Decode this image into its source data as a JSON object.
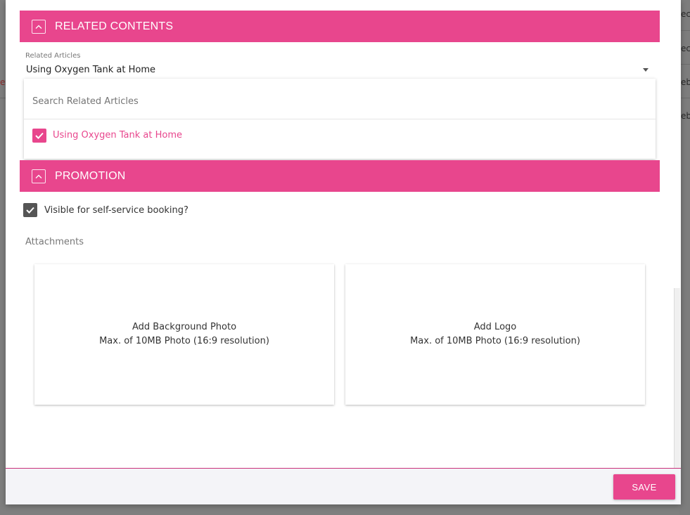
{
  "background": {
    "right_fragments": [
      "ec",
      "ec",
      "eb",
      "eb"
    ],
    "left_fragment": "e"
  },
  "related_contents": {
    "header": "RELATED CONTENTS",
    "field_label": "Related Articles",
    "selected_value": "Using Oxygen Tank at Home",
    "search_placeholder": "Search Related Articles",
    "options": [
      {
        "label": "Using Oxygen Tank at Home",
        "checked": true
      }
    ]
  },
  "promotion": {
    "header": "PROMOTION",
    "visible_label": "Visible for self-service booking?",
    "visible_checked": true,
    "attachments_label": "Attachments",
    "cards": [
      {
        "title": "Add Background Photo",
        "hint": "Max. of 10MB Photo (16:9 resolution)"
      },
      {
        "title": "Add Logo",
        "hint": "Max. of 10MB Photo (16:9 resolution)"
      }
    ]
  },
  "footer": {
    "save_label": "SAVE"
  },
  "colors": {
    "accent": "#e8468d",
    "checkbox_dark": "#555555"
  },
  "icons": [
    "chevron-up-icon",
    "check-icon",
    "caret-down-icon"
  ]
}
